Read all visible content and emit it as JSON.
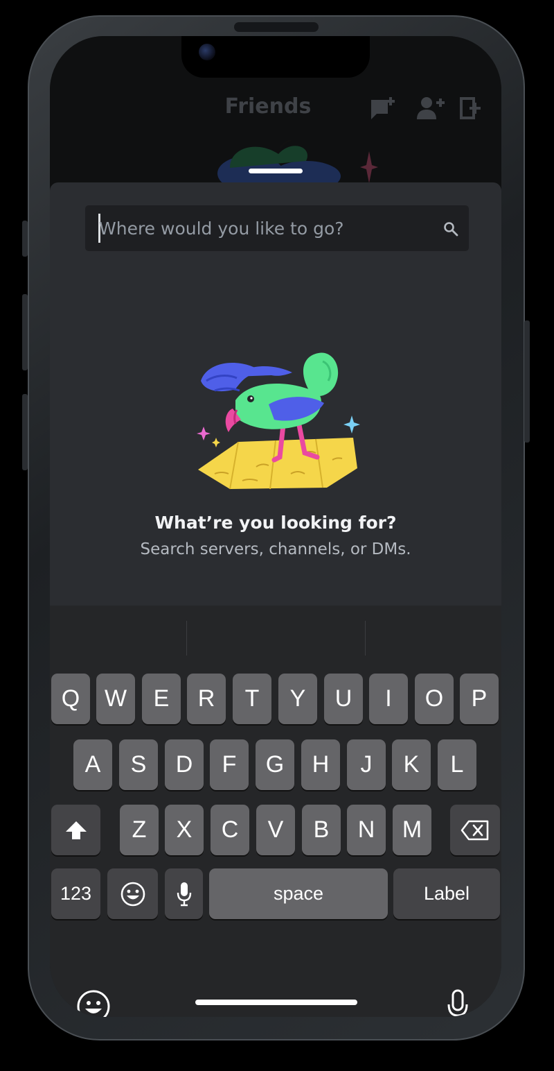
{
  "header": {
    "title": "Friends"
  },
  "search": {
    "placeholder": "Where would you like to go?",
    "value": ""
  },
  "empty_state": {
    "title": "What’re you looking for?",
    "subtitle": "Search servers, channels, or DMs."
  },
  "keyboard": {
    "row1": [
      "Q",
      "W",
      "E",
      "R",
      "T",
      "Y",
      "U",
      "I",
      "O",
      "P"
    ],
    "row2": [
      "A",
      "S",
      "D",
      "F",
      "G",
      "H",
      "J",
      "K",
      "L"
    ],
    "row3": [
      "Z",
      "X",
      "C",
      "V",
      "B",
      "N",
      "M"
    ],
    "numbers_label": "123",
    "space_label": "space",
    "return_label": "Label"
  },
  "colors": {
    "sheet_bg": "#2b2d31",
    "search_bg": "#1e1f22",
    "keyboard_bg": "#252628",
    "key_bg": "#656568",
    "key_dark_bg": "#444447"
  },
  "icons": [
    "new-message-icon",
    "add-friend-icon",
    "add-server-icon",
    "search-icon",
    "shift-icon",
    "backspace-icon",
    "emoji-icon",
    "dictation-icon"
  ]
}
